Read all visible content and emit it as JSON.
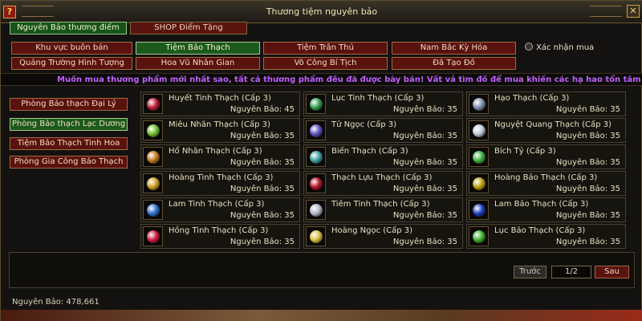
{
  "window": {
    "title": "Thương tiệm nguyên bảo",
    "help_label": "?",
    "close_label": "✕"
  },
  "tabs": [
    {
      "label": "Nguyên Bảo thương điếm"
    },
    {
      "label": "SHOP Điểm Tặng"
    }
  ],
  "categories": [
    {
      "label": "Khu vực buôn bán"
    },
    {
      "label": "Tiệm Bảo Thạch"
    },
    {
      "label": "Tiệm Trân Thú"
    },
    {
      "label": "Nam Bắc Kỳ Hóa"
    },
    {
      "label": "Quảng Trường Hình Tượng"
    },
    {
      "label": "Hoa Vũ Nhân Gian"
    },
    {
      "label": "Võ Công Bí Tịch"
    },
    {
      "label": "Đã Tạo Đồ"
    }
  ],
  "confirm_label": "Xác nhận mua",
  "marquee": "Muốn mua thương phẩm mới nhất sao, tất cả thương phẩm đều đã được bày bán! Vất vả tìm đồ để mua khiến các hạ hao tổn tâm sức rồi ư, gần đi",
  "shops": [
    {
      "label": "Phòng Bảo thạch Đại Lý"
    },
    {
      "label": "Phòng Bảo thạch Lạc Dương"
    },
    {
      "label": "Tiệm Bảo Thạch Tinh Hoa"
    },
    {
      "label": "Phòng Gia Công Bảo Thạch"
    }
  ],
  "items": [
    {
      "name": "Huyết Tinh Thạch (Cấp 3)",
      "price": "Nguyên Bảo: 45",
      "color": "#c0203a"
    },
    {
      "name": "Lục Tinh Thạch (Cấp 3)",
      "price": "Nguyên Bảo: 35",
      "color": "#30a050"
    },
    {
      "name": "Hạo Thạch (Cấp 3)",
      "price": "Nguyên Bảo: 35",
      "color": "#8090b0"
    },
    {
      "name": "Miêu Nhãn Thạch (Cấp 3)",
      "price": "Nguyên Bảo: 35",
      "color": "#70c030"
    },
    {
      "name": "Tử Ngọc (Cấp 3)",
      "price": "Nguyên Bảo: 35",
      "color": "#6050c0"
    },
    {
      "name": "Nguyệt Quang Thạch (Cấp 3)",
      "price": "Nguyên Bảo: 35",
      "color": "#c0c8d8"
    },
    {
      "name": "Hổ Nhãn Thạch (Cấp 3)",
      "price": "Nguyên Bảo: 35",
      "color": "#c07820"
    },
    {
      "name": "Biến Thạch (Cấp 3)",
      "price": "Nguyên Bảo: 35",
      "color": "#40a0a0"
    },
    {
      "name": "Bích Tỷ (Cấp 3)",
      "price": "Nguyên Bảo: 35",
      "color": "#40b040"
    },
    {
      "name": "Hoàng Tinh Thạch (Cấp 3)",
      "price": "Nguyên Bảo: 35",
      "color": "#d0a020"
    },
    {
      "name": "Thạch Lựu Thạch (Cấp 3)",
      "price": "Nguyên Bảo: 35",
      "color": "#b01828"
    },
    {
      "name": "Hoàng Bảo Thạch (Cấp 3)",
      "price": "Nguyên Bảo: 35",
      "color": "#c0a010"
    },
    {
      "name": "Lam Tinh Thạch (Cấp 3)",
      "price": "Nguyên Bảo: 35",
      "color": "#3070d0"
    },
    {
      "name": "Tiêm Tinh Thạch (Cấp 3)",
      "price": "Nguyên Bảo: 35",
      "color": "#b0b8c8"
    },
    {
      "name": "Lam Bảo Thạch (Cấp 3)",
      "price": "Nguyên Bảo: 35",
      "color": "#2040c0"
    },
    {
      "name": "Hồng Tinh Thạch (Cấp 3)",
      "price": "Nguyên Bảo: 35",
      "color": "#d02040"
    },
    {
      "name": "Hoàng Ngọc (Cấp 3)",
      "price": "Nguyên Bảo: 35",
      "color": "#d8c040"
    },
    {
      "name": "Lục Bảo Thạch (Cấp 3)",
      "price": "Nguyên Bảo: 35",
      "color": "#40b030"
    }
  ],
  "pager": {
    "prev": "Trước",
    "page": "1/2",
    "next": "Sau"
  },
  "balance": "Nguyên Bảo: 478,661"
}
